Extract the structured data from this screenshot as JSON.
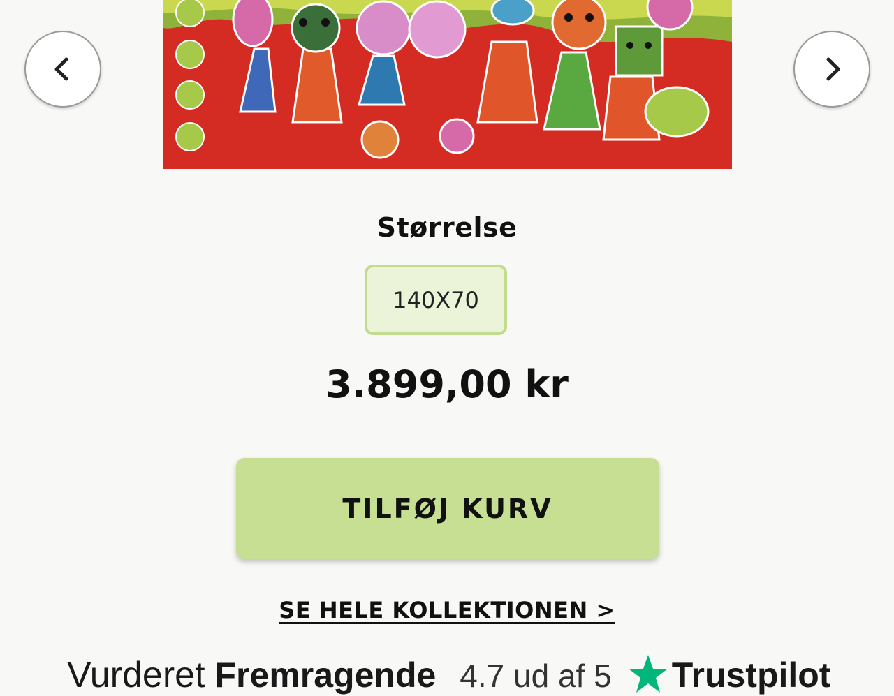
{
  "carousel": {
    "prev_label": "Previous",
    "next_label": "Next",
    "artwork_alt": "Naivistisk maleri med farverige figurer på rød baggrund"
  },
  "product": {
    "size_heading": "Størrelse",
    "size_options": [
      "140X70"
    ],
    "selected_size": "140X70",
    "price": "3.899,00 kr"
  },
  "actions": {
    "add_to_cart": "TILFØJ KURV",
    "see_collection": "SE HELE KOLLEKTIONEN >"
  },
  "trustpilot": {
    "label": "Vurderet",
    "rating_word": "Fremragende",
    "score": "4.7 ud af 5",
    "brand": "Trustpilot",
    "star_color": "#00b67a"
  },
  "colors": {
    "accent": "#c6df93",
    "background": "#f8f8f6"
  }
}
